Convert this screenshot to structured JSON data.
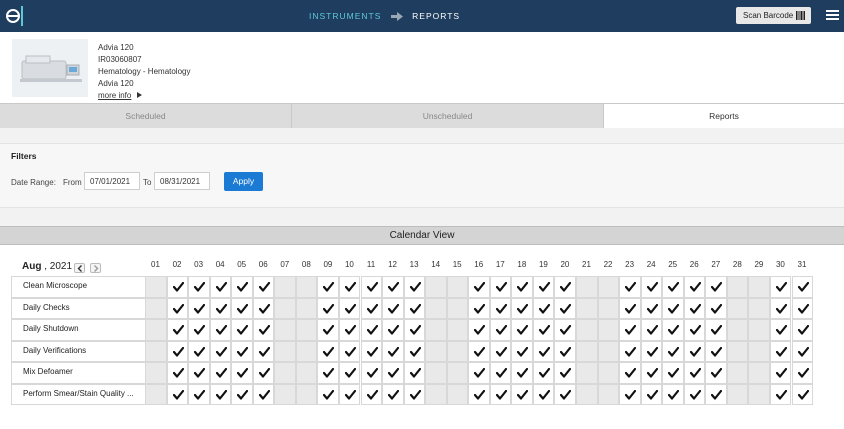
{
  "header": {
    "crumbs": [
      "INSTRUMENTS",
      "REPORTS"
    ],
    "scan_label": "Scan Barcode"
  },
  "instrument": {
    "lines": [
      "Advia 120",
      "IR03060807",
      "Hematology - Hematology",
      "Advia 120"
    ],
    "more": "more info"
  },
  "tabs": [
    {
      "label": "Scheduled",
      "active": false
    },
    {
      "label": "Unscheduled",
      "active": false
    },
    {
      "label": "Reports",
      "active": true
    }
  ],
  "filters": {
    "title": "Filters",
    "date_range_label": "Date Range:",
    "from_label": "From",
    "to_label": "To",
    "from_value": "07/01/2021",
    "to_value": "08/31/2021",
    "apply_label": "Apply"
  },
  "calendar": {
    "title": "Calendar View",
    "month": "Aug",
    "year": ", 2021",
    "days": [
      "01",
      "02",
      "03",
      "04",
      "05",
      "06",
      "07",
      "08",
      "09",
      "10",
      "11",
      "12",
      "13",
      "14",
      "15",
      "16",
      "17",
      "18",
      "19",
      "20",
      "21",
      "22",
      "23",
      "24",
      "25",
      "26",
      "27",
      "28",
      "29",
      "30",
      "31"
    ],
    "checked_days": [
      "02",
      "03",
      "04",
      "05",
      "06",
      "09",
      "10",
      "11",
      "12",
      "13",
      "16",
      "17",
      "18",
      "19",
      "20",
      "23",
      "24",
      "25",
      "26",
      "27",
      "30",
      "31"
    ],
    "tasks": [
      "Clean Microscope",
      "Daily Checks",
      "Daily Shutdown",
      "Daily Verifications",
      "Mix Defoamer",
      "Perform Smear/Stain Quality ..."
    ]
  },
  "colors": {
    "header_bg": "#1f3d5e",
    "crumb_accent": "#5fc8d8",
    "apply_bg": "#1b7ad4"
  },
  "icons": {
    "logo": "brand-logo-icon",
    "arrow": "arrow-right-icon",
    "barcode": "barcode-icon",
    "menu": "hamburger-menu-icon",
    "check": "check-icon",
    "prev": "chevron-left-icon",
    "next": "chevron-right-icon"
  }
}
